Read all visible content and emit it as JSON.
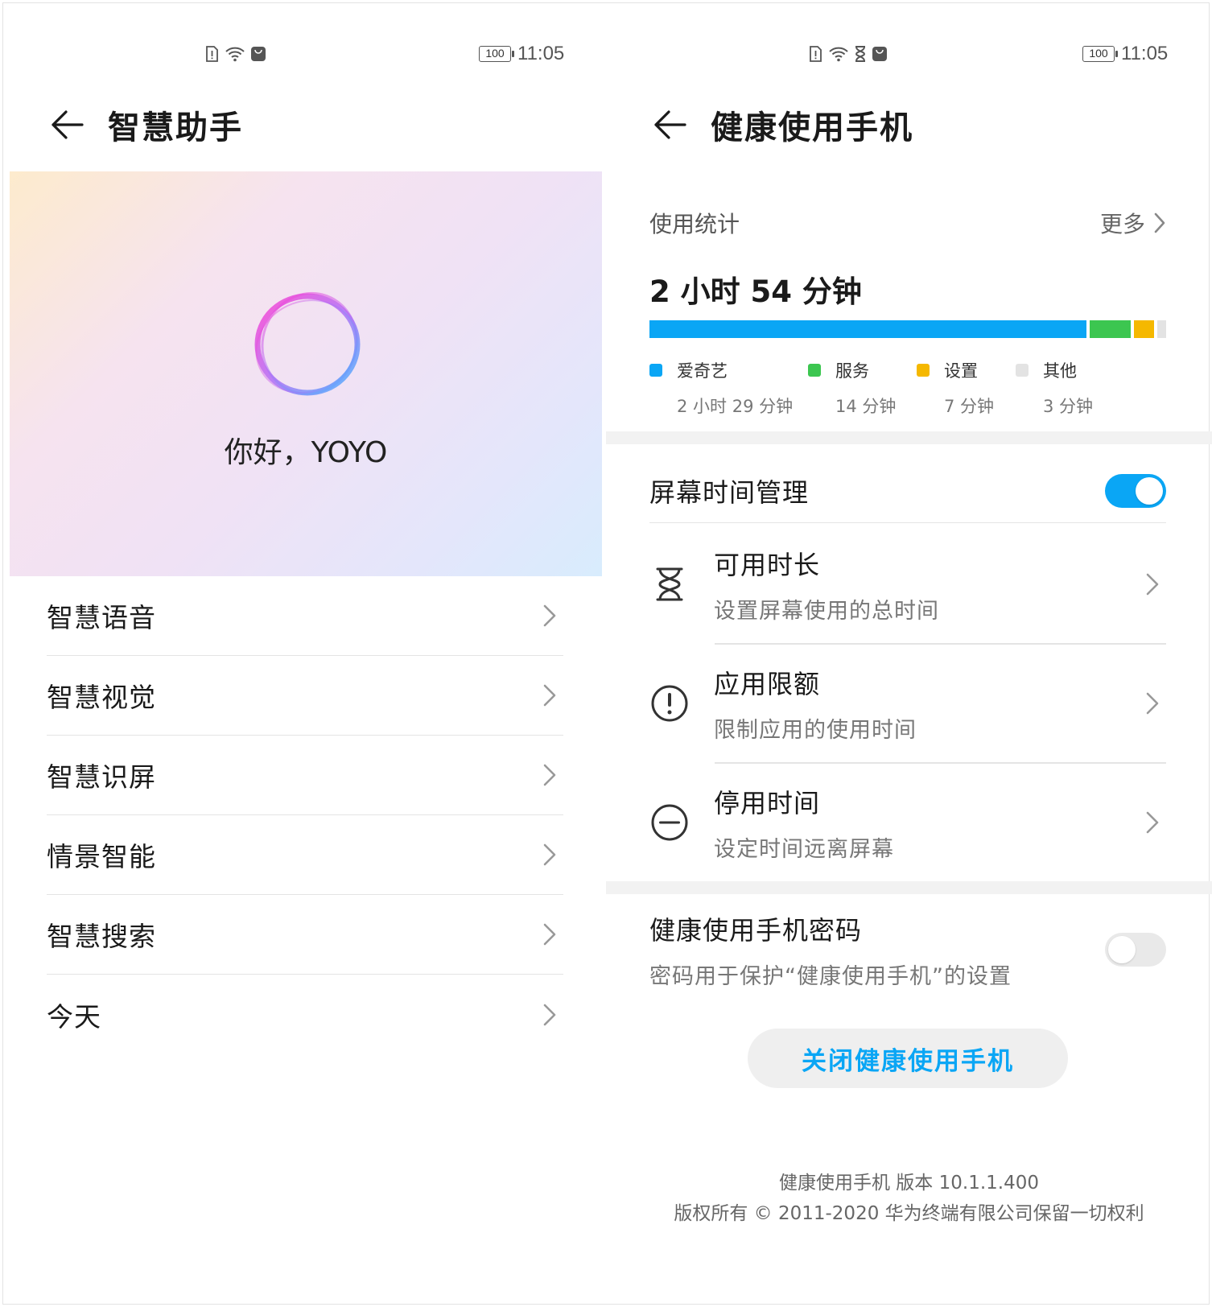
{
  "left": {
    "status_time": "11:05",
    "battery": "100",
    "title": "智慧助手",
    "greeting": "你好，YOYO",
    "menu": [
      {
        "label": "智慧语音"
      },
      {
        "label": "智慧视觉"
      },
      {
        "label": "智慧识屏"
      },
      {
        "label": "情景智能"
      },
      {
        "label": "智慧搜索"
      },
      {
        "label": "今天"
      }
    ]
  },
  "right": {
    "status_time": "11:05",
    "battery": "100",
    "title": "健康使用手机",
    "usage_label": "使用统计",
    "more_label": "更多",
    "total_time": "2 小时 54 分钟",
    "usage_breakdown": [
      {
        "name": "爱奇艺",
        "time": "2 小时 29 分钟",
        "minutes": 149,
        "color": "#0aa6f5"
      },
      {
        "name": "服务",
        "time": "14 分钟",
        "minutes": 14,
        "color": "#3cc650"
      },
      {
        "name": "设置",
        "time": "7 分钟",
        "minutes": 7,
        "color": "#f5b800"
      },
      {
        "name": "其他",
        "time": "3 分钟",
        "minutes": 3,
        "color": "#e3e3e3"
      }
    ],
    "screen_time_mgmt": {
      "label": "屏幕时间管理",
      "enabled": true
    },
    "options": [
      {
        "title": "可用时长",
        "subtitle": "设置屏幕使用的总时间",
        "icon": "hourglass-icon"
      },
      {
        "title": "应用限额",
        "subtitle": "限制应用的使用时间",
        "icon": "alert-circle-icon"
      },
      {
        "title": "停用时间",
        "subtitle": "设定时间远离屏幕",
        "icon": "minus-circle-icon"
      }
    ],
    "password": {
      "title": "健康使用手机密码",
      "subtitle": "密码用于保护“健康使用手机”的设置",
      "enabled": false
    },
    "close_button": "关闭健康使用手机",
    "footer_version": "健康使用手机 版本 10.1.1.400",
    "footer_copyright": "版权所有 © 2011-2020 华为终端有限公司保留一切权利"
  },
  "colors": {
    "accent": "#0aa6f5"
  }
}
